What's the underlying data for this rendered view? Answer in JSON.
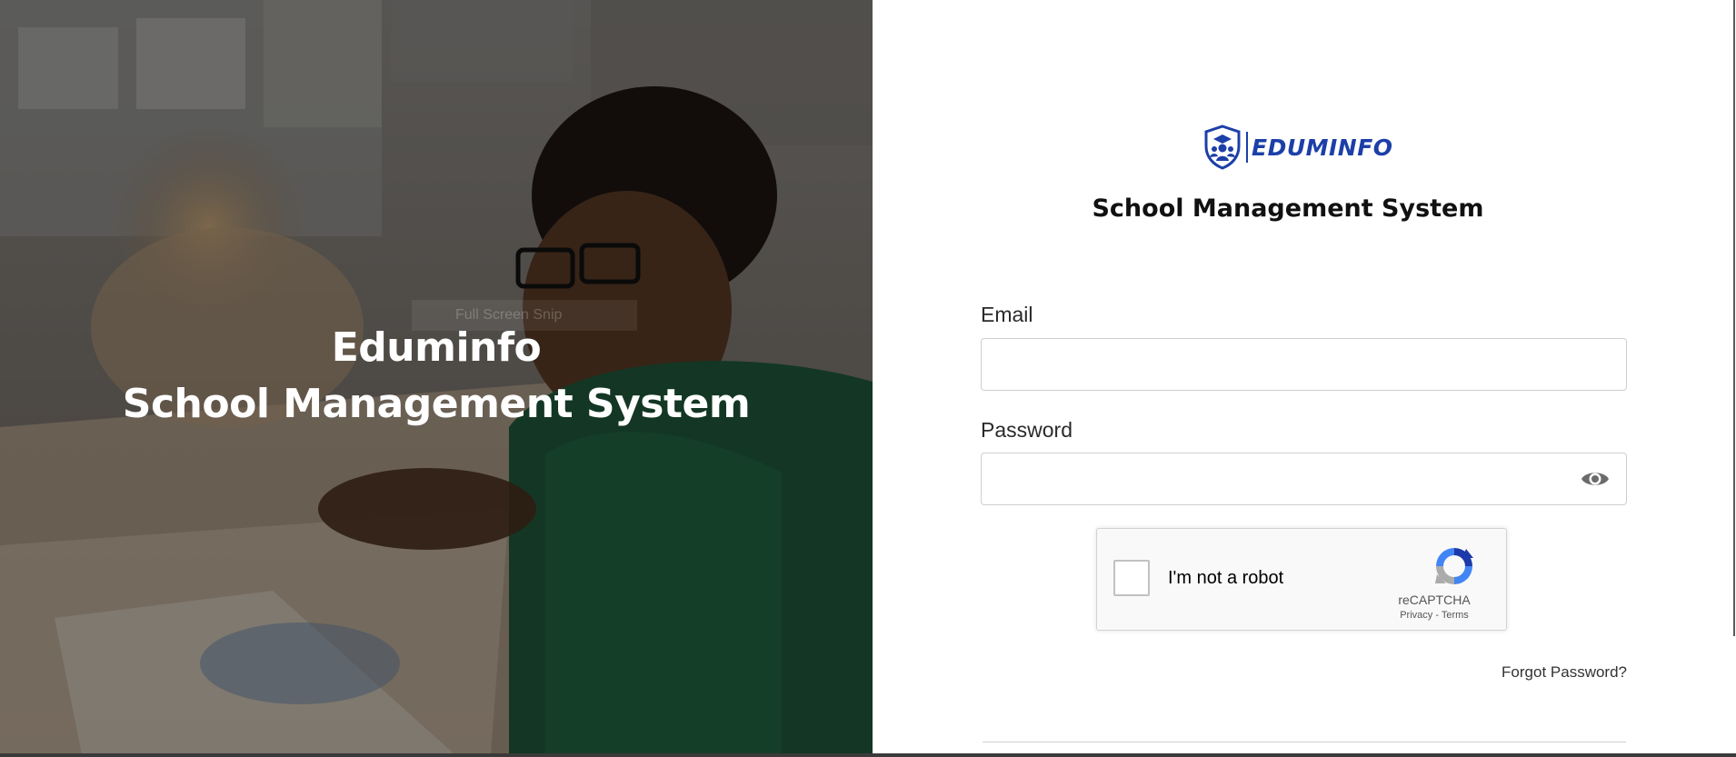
{
  "hero": {
    "snip_text": "Full Screen Snip",
    "title_line1": "Eduminfo",
    "title_line2": "School Management System"
  },
  "login": {
    "logo_text": "EDUMINFO",
    "subtitle": "School Management System",
    "email": {
      "label": "Email",
      "value": "",
      "placeholder": ""
    },
    "password": {
      "label": "Password",
      "value": "",
      "placeholder": ""
    },
    "captcha": {
      "label": "I'm not a robot",
      "brand": "reCAPTCHA",
      "privacy": "Privacy",
      "separator": " - ",
      "terms": "Terms"
    },
    "forgot_password": "Forgot Password?"
  },
  "colors": {
    "brand_blue": "#1c3fa8",
    "hero_overlay": "#00000061"
  },
  "icons": {
    "logo": "shield-graduate-icon",
    "password_toggle": "eye-icon",
    "captcha": "recaptcha-icon"
  }
}
